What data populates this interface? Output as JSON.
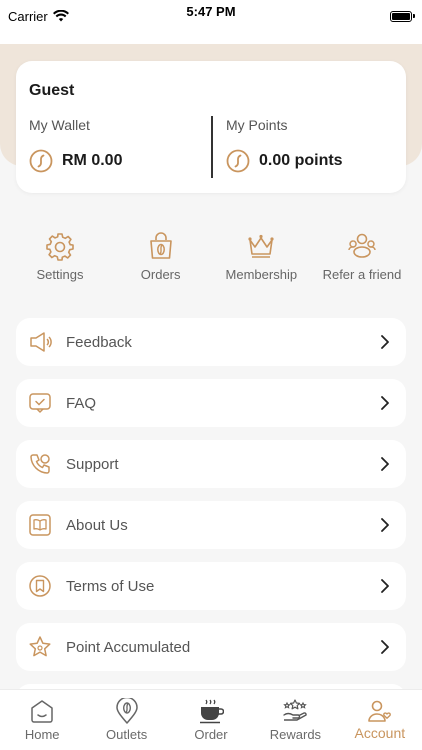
{
  "status_bar": {
    "carrier": "Carrier",
    "time": "5:47 PM"
  },
  "profile": {
    "name": "Guest",
    "wallet_label": "My Wallet",
    "wallet_value": "RM 0.00",
    "points_label": "My Points",
    "points_value": "0.00 points"
  },
  "quick_actions": [
    {
      "label": "Settings",
      "icon": "settings-icon"
    },
    {
      "label": "Orders",
      "icon": "orders-icon"
    },
    {
      "label": "Membership",
      "icon": "crown-icon"
    },
    {
      "label": "Refer a friend",
      "icon": "refer-icon"
    }
  ],
  "menu": [
    {
      "label": "Feedback",
      "icon": "megaphone-icon"
    },
    {
      "label": "FAQ",
      "icon": "faq-icon"
    },
    {
      "label": "Support",
      "icon": "phone-icon"
    },
    {
      "label": "About Us",
      "icon": "book-icon"
    },
    {
      "label": "Terms of Use",
      "icon": "bookmark-icon"
    },
    {
      "label": "Point Accumulated",
      "icon": "star-icon"
    }
  ],
  "tabs": [
    {
      "label": "Home",
      "icon": "home-icon",
      "active": false
    },
    {
      "label": "Outlets",
      "icon": "location-icon",
      "active": false
    },
    {
      "label": "Order",
      "icon": "coffee-cup-icon",
      "active": false
    },
    {
      "label": "Rewards",
      "icon": "rewards-icon",
      "active": false
    },
    {
      "label": "Account",
      "icon": "account-icon",
      "active": true
    }
  ],
  "colors": {
    "accent": "#c9955e",
    "header_band": "#efe5da",
    "background": "#f6f6f6"
  }
}
